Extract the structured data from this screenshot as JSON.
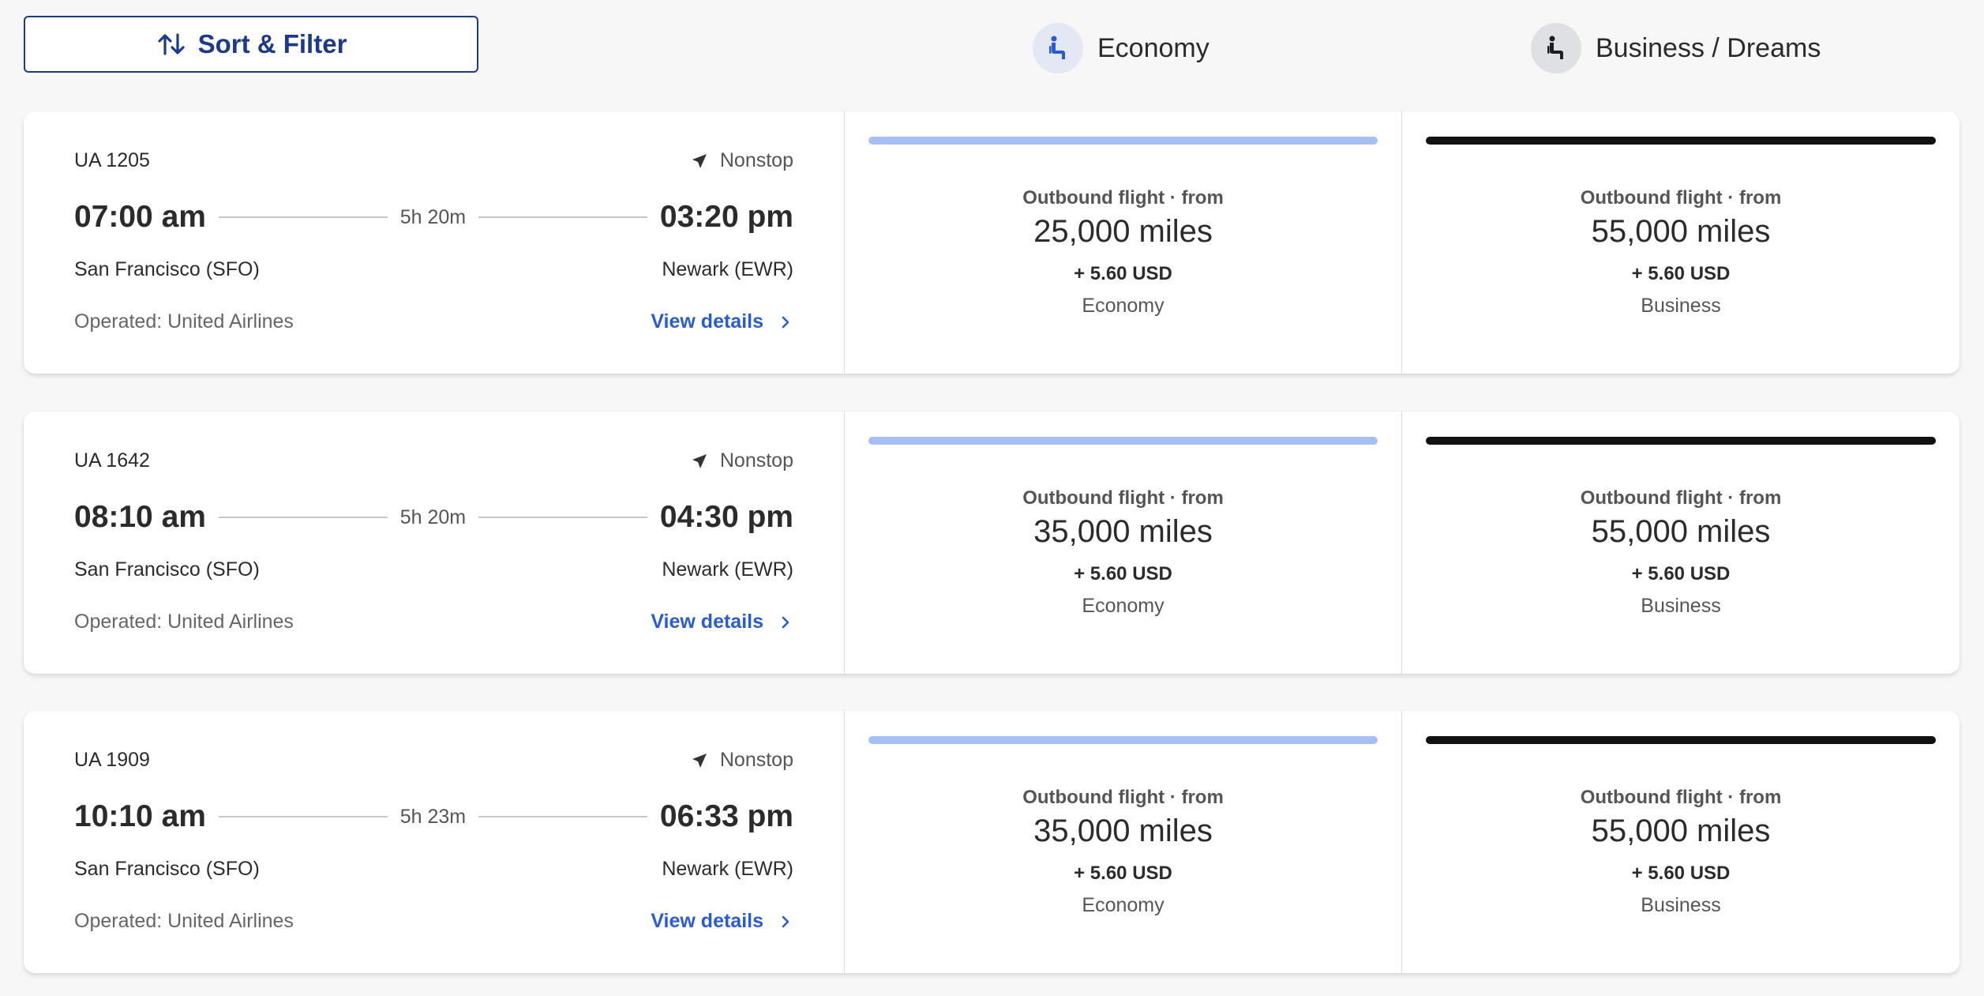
{
  "toolbar": {
    "sort_filter_label": "Sort & Filter",
    "sort_icon": "sort-arrows-icon"
  },
  "cabins": {
    "economy": {
      "label": "Economy",
      "icon": "seat-icon",
      "accent": "#a6bff4"
    },
    "business": {
      "label": "Business / Dreams",
      "icon": "seat-icon",
      "accent": "#111111"
    }
  },
  "flights": [
    {
      "number": "UA 1205",
      "stops": "Nonstop",
      "depart_time": "07:00 am",
      "duration": "5h 20m",
      "arrive_time": "03:20 pm",
      "origin": "San Francisco (SFO)",
      "destination": "Newark (EWR)",
      "operated": "Operated: United Airlines",
      "details_label": "View details",
      "fares": [
        {
          "label": "Outbound flight · from",
          "miles": "25,000 miles",
          "usd": "+ 5.60 USD",
          "cabin": "Economy"
        },
        {
          "label": "Outbound flight · from",
          "miles": "55,000 miles",
          "usd": "+ 5.60 USD",
          "cabin": "Business"
        }
      ]
    },
    {
      "number": "UA 1642",
      "stops": "Nonstop",
      "depart_time": "08:10 am",
      "duration": "5h 20m",
      "arrive_time": "04:30 pm",
      "origin": "San Francisco (SFO)",
      "destination": "Newark (EWR)",
      "operated": "Operated: United Airlines",
      "details_label": "View details",
      "fares": [
        {
          "label": "Outbound flight · from",
          "miles": "35,000 miles",
          "usd": "+ 5.60 USD",
          "cabin": "Economy"
        },
        {
          "label": "Outbound flight · from",
          "miles": "55,000 miles",
          "usd": "+ 5.60 USD",
          "cabin": "Business"
        }
      ]
    },
    {
      "number": "UA 1909",
      "stops": "Nonstop",
      "depart_time": "10:10 am",
      "duration": "5h 23m",
      "arrive_time": "06:33 pm",
      "origin": "San Francisco (SFO)",
      "destination": "Newark (EWR)",
      "operated": "Operated: United Airlines",
      "details_label": "View details",
      "fares": [
        {
          "label": "Outbound flight · from",
          "miles": "35,000 miles",
          "usd": "+ 5.60 USD",
          "cabin": "Economy"
        },
        {
          "label": "Outbound flight · from",
          "miles": "55,000 miles",
          "usd": "+ 5.60 USD",
          "cabin": "Business"
        }
      ]
    }
  ]
}
